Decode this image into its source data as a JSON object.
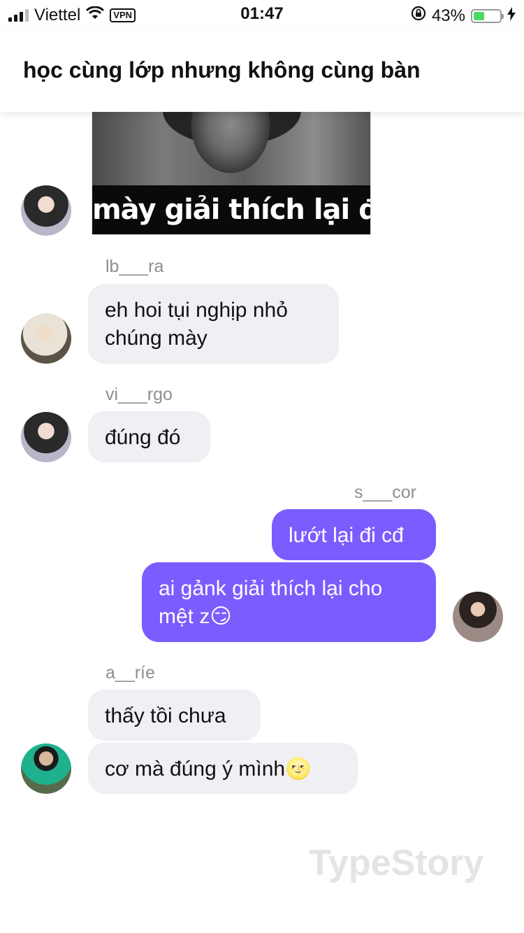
{
  "status_bar": {
    "carrier": "Viettel",
    "vpn": "VPN",
    "time": "01:47",
    "battery_percent": "43%",
    "battery_level": 0.43,
    "icons": [
      "signal-icon",
      "wifi-icon",
      "orientation-lock-icon",
      "battery-icon",
      "charging-icon"
    ]
  },
  "header": {
    "title": "học cùng lớp nhưng không cùng bàn"
  },
  "meme": {
    "caption": "mày giải thích lại đi"
  },
  "messages": [
    {
      "sender": "lb___ra",
      "text": "eh hoi tụi nghịp nhỏ chúng mày"
    },
    {
      "sender": "vi___rgo",
      "text": "đúng đó"
    },
    {
      "sender": "s___cor",
      "texts": [
        "lướt lại đi cđ",
        "ai gảnk giải thích lại cho mệt z😏"
      ]
    },
    {
      "sender": "a__ríe",
      "texts": [
        "thấy tồi chưa",
        "cơ mà đúng ý mình🌝"
      ]
    }
  ],
  "watermark": "TypeStory",
  "colors": {
    "outgoing_bubble": "#7c5cff",
    "incoming_bubble": "#efeff4",
    "name_text": "#8e8e93"
  }
}
